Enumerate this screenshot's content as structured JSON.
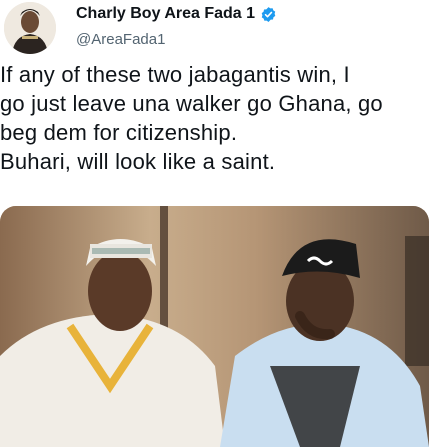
{
  "tweet": {
    "display_name": "Charly Boy Area Fada 1",
    "handle": "@AreaFada1",
    "verified": true,
    "text_lines": [
      "If any of these two jabagantis win, I",
      "go just leave una walker go Ghana, go",
      "beg dem for citizenship.",
      "Buhari, will look like a saint."
    ]
  },
  "colors": {
    "name": "#0f1419",
    "handle": "#536471",
    "verified_badge": "#1d9bf0"
  },
  "icons": {
    "verified": "verified-badge-icon",
    "avatar": "profile-avatar"
  }
}
